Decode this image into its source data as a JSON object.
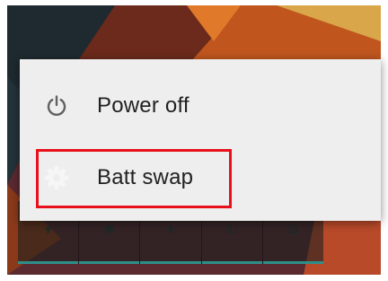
{
  "power_menu": {
    "items": [
      {
        "label": "Power off",
        "icon": "power-icon"
      },
      {
        "label": "Batt swap",
        "icon": "gear-icon"
      }
    ]
  },
  "quick_settings": {
    "tiles": [
      {
        "icon": "wifi-icon",
        "glyph": "▾"
      },
      {
        "icon": "bluetooth-icon",
        "glyph": "✱"
      },
      {
        "icon": "airplane-icon",
        "glyph": "✈"
      },
      {
        "icon": "rotate-icon",
        "glyph": "↻"
      },
      {
        "icon": "settings-icon",
        "glyph": "⚙"
      }
    ]
  },
  "colors": {
    "highlight": "#e8111b",
    "dialog_bg": "#eeeeee",
    "accent_line": "#2e8f8a"
  }
}
